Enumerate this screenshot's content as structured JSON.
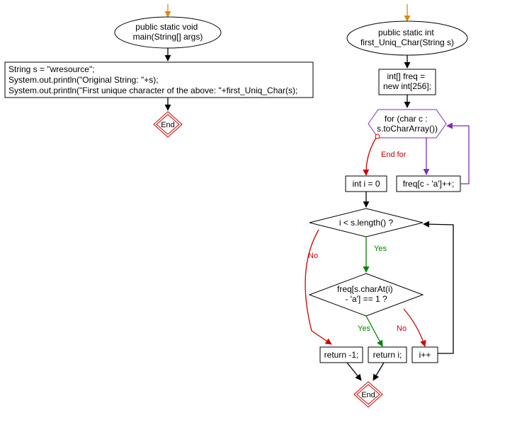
{
  "left": {
    "entry": "public static void\nmain(String[] args)",
    "body": "String s = \"wresource\";\nSystem.out.println(\"Original String: \"+s);\nSystem.out.println(\"First unique character of the above: \"+first_Uniq_Char(s);",
    "end": "End"
  },
  "right": {
    "entry": "public static int\nfirst_Uniq_Char(String s)",
    "alloc": "int[] freq =\nnew int[256];",
    "for": "for (char c :\ns.toCharArray())",
    "endfor": "End for",
    "inc": "freq[c - 'a']++;",
    "init_i": "int i = 0",
    "cond1": "i < s.length() ?",
    "cond2": "freq[s.charAt(i)\n- 'a'] == 1 ?",
    "ret_neg": "return -1;",
    "ret_i": "return i;",
    "ipp": "i++",
    "end": "End",
    "yes": "Yes",
    "no": "No"
  }
}
